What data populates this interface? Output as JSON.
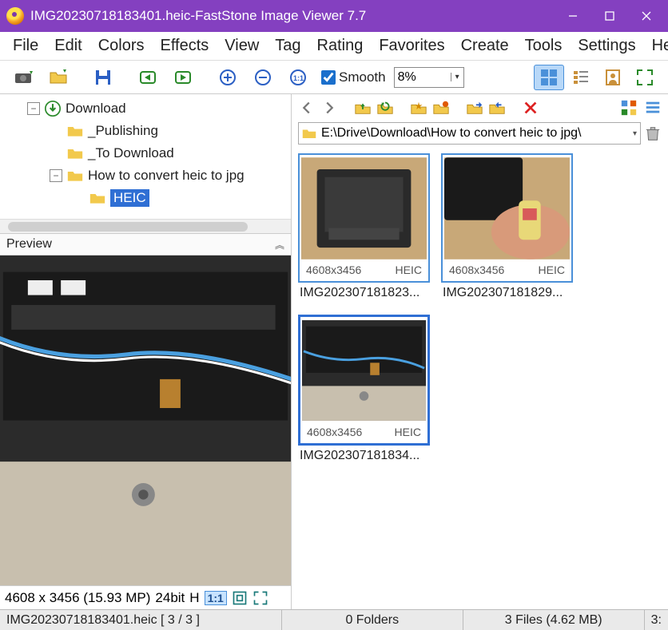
{
  "window": {
    "filename": "IMG20230718183401.heic",
    "sep": "  -  ",
    "app_title": "FastStone Image Viewer 7.7"
  },
  "menu": [
    "File",
    "Edit",
    "Colors",
    "Effects",
    "View",
    "Tag",
    "Rating",
    "Favorites",
    "Create",
    "Tools",
    "Settings",
    "Help"
  ],
  "toolbar": {
    "smooth_label": "Smooth",
    "smooth_checked": true,
    "zoom_value": "8%"
  },
  "tree": [
    {
      "depth": 1,
      "twisty": "minus",
      "icon": "download",
      "label": "Download"
    },
    {
      "depth": 2,
      "twisty": "none",
      "icon": "folder",
      "label": "_Publishing"
    },
    {
      "depth": 2,
      "twisty": "none",
      "icon": "folder",
      "label": "_To Download"
    },
    {
      "depth": 2,
      "twisty": "minus",
      "icon": "folder",
      "label": "How to convert heic to jpg"
    },
    {
      "depth": 3,
      "twisty": "none",
      "icon": "folder",
      "label": "HEIC",
      "selected": true
    }
  ],
  "preview": {
    "header": "Preview",
    "info_dims": "4608 x 3456 (15.93 MP)",
    "info_bits": "24bit",
    "info_code": "H",
    "ratio": "1:1"
  },
  "path": "E:\\Drive\\Download\\How to convert heic to jpg\\",
  "thumbs": [
    {
      "dims": "4608x3456",
      "fmt": "HEIC",
      "name": "IMG202307181823...",
      "selected": false,
      "img": "a"
    },
    {
      "dims": "4608x3456",
      "fmt": "HEIC",
      "name": "IMG202307181829...",
      "selected": false,
      "img": "b"
    },
    {
      "dims": "4608x3456",
      "fmt": "HEIC",
      "name": "IMG202307181834...",
      "selected": true,
      "img": "c"
    }
  ],
  "status": {
    "file_pos": "IMG20230718183401.heic [ 3 / 3 ]",
    "folders": "0 Folders",
    "files": "3 Files (4.62 MB)",
    "extra": "3:"
  }
}
